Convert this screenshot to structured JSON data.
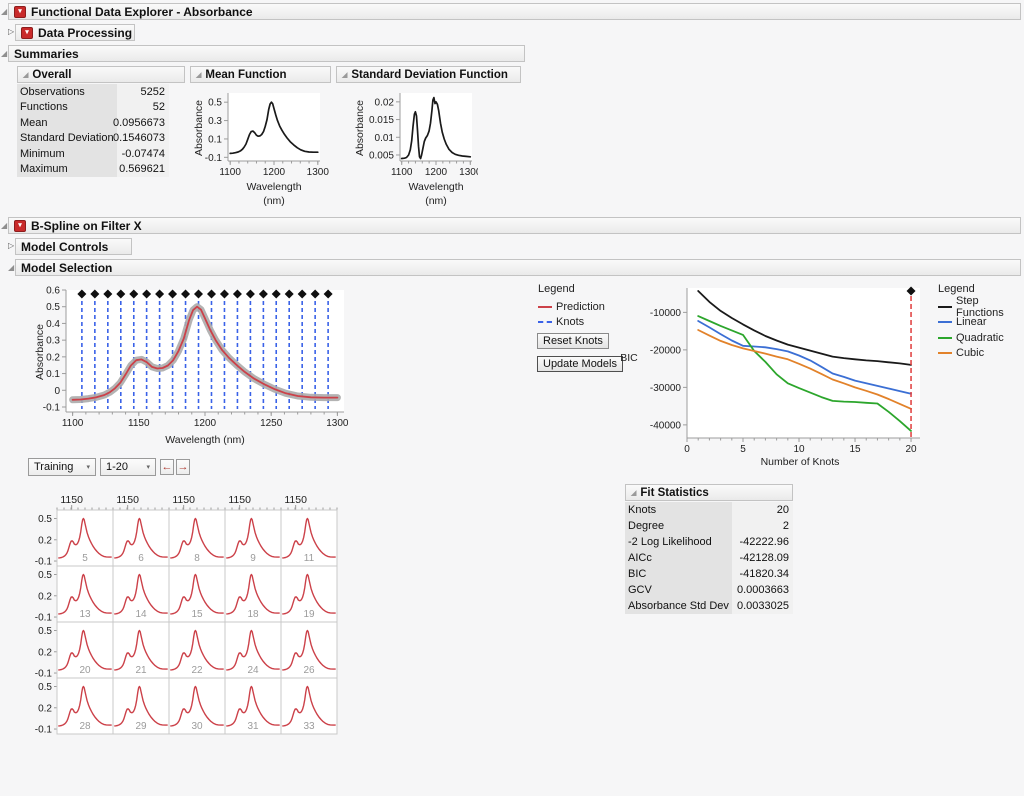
{
  "titles": {
    "fde": "Functional Data Explorer - Absorbance",
    "data_processing": "Data Processing",
    "summaries": "Summaries",
    "overall": "Overall",
    "mean_function": "Mean Function",
    "std_dev_function": "Standard Deviation Function",
    "bspline": "B-Spline on Filter X",
    "model_controls": "Model Controls",
    "model_selection": "Model Selection",
    "fit_statistics": "Fit Statistics"
  },
  "overall_table": {
    "rows": [
      {
        "label": "Observations",
        "value": "5252"
      },
      {
        "label": "Functions",
        "value": "52"
      },
      {
        "label": "Mean",
        "value": "0.0956673"
      },
      {
        "label": "Standard Deviation",
        "value": "0.1546073"
      },
      {
        "label": "Minimum",
        "value": "-0.07474"
      },
      {
        "label": "Maximum",
        "value": "0.569621"
      }
    ]
  },
  "fit_table": {
    "rows": [
      {
        "label": "Knots",
        "value": "20"
      },
      {
        "label": "Degree",
        "value": "2"
      },
      {
        "label": "-2 Log Likelihood",
        "value": "-42222.96"
      },
      {
        "label": "AICc",
        "value": "-42128.09"
      },
      {
        "label": "BIC",
        "value": "-41820.34"
      },
      {
        "label": "GCV",
        "value": "0.0003663"
      },
      {
        "label": "Absorbance Std Dev",
        "value": "0.0033025"
      }
    ]
  },
  "spline_legend": {
    "title": "Legend",
    "items": [
      {
        "label": "Prediction",
        "color": "#cc4149",
        "dash": "solid"
      },
      {
        "label": "Knots",
        "color": "#3a62e8",
        "dash": "dashed"
      }
    ]
  },
  "bic_legend": {
    "title": "Legend",
    "items": [
      {
        "label": "Step Functions",
        "color": "#1a1a1a",
        "dash": "solid"
      },
      {
        "label": "Linear",
        "color": "#3b6fd4",
        "dash": "solid"
      },
      {
        "label": "Quadratic",
        "color": "#2ca62c",
        "dash": "solid"
      },
      {
        "label": "Cubic",
        "color": "#e2822a",
        "dash": "solid"
      }
    ]
  },
  "buttons": {
    "reset_knots": "Reset Knots",
    "update_models": "Update Models"
  },
  "pager": {
    "set": "Training",
    "range": "1-20",
    "prev": "←",
    "next": "→"
  },
  "chart_data": [
    {
      "id": "mean_function",
      "type": "line",
      "title": "Mean Function",
      "xlabel": "Wavelength (nm)",
      "xlabel_lines": [
        "Wavelength",
        "(nm)"
      ],
      "ylabel": "Absorbance",
      "xlim": [
        1095,
        1305
      ],
      "ylim": [
        -0.14,
        0.6
      ],
      "xticks": [
        1100,
        1200,
        1300
      ],
      "yticks": [
        0.5,
        0.3,
        0.1,
        -0.1
      ],
      "series": [
        {
          "name": "Mean",
          "color": "#1a1a1a",
          "width": 1.7,
          "x": [
            1100,
            1106,
            1112,
            1118,
            1124,
            1128,
            1132,
            1136,
            1140,
            1144,
            1148,
            1152,
            1156,
            1160,
            1164,
            1168,
            1172,
            1176,
            1180,
            1184,
            1188,
            1191,
            1194,
            1197,
            1200,
            1204,
            1208,
            1213,
            1218,
            1224,
            1230,
            1237,
            1245,
            1253,
            1261,
            1270,
            1280,
            1290,
            1300
          ],
          "y": [
            -0.057,
            -0.055,
            -0.05,
            -0.042,
            -0.028,
            -0.012,
            0.012,
            0.045,
            0.095,
            0.148,
            0.18,
            0.185,
            0.168,
            0.14,
            0.13,
            0.133,
            0.148,
            0.18,
            0.235,
            0.31,
            0.42,
            0.48,
            0.5,
            0.482,
            0.43,
            0.36,
            0.3,
            0.24,
            0.195,
            0.15,
            0.11,
            0.07,
            0.035,
            0.005,
            -0.018,
            -0.034,
            -0.042,
            -0.044,
            -0.044
          ]
        }
      ]
    },
    {
      "id": "std_dev_function",
      "type": "line",
      "title": "Standard Deviation Function",
      "xlabel": "Wavelength (nm)",
      "xlabel_lines": [
        "Wavelength",
        "(nm)"
      ],
      "ylabel": "Absorbance",
      "xlim": [
        1095,
        1305
      ],
      "ylim": [
        0.0033,
        0.0225
      ],
      "xticks": [
        1100,
        1200,
        1300
      ],
      "yticks": [
        0.02,
        0.015,
        0.01,
        0.005
      ],
      "series": [
        {
          "name": "Std Dev",
          "color": "#1a1a1a",
          "width": 1.7,
          "x": [
            1100,
            1108,
            1114,
            1120,
            1125,
            1129,
            1133,
            1137,
            1140,
            1143,
            1146,
            1149,
            1152,
            1155,
            1158,
            1162,
            1166,
            1170,
            1175,
            1180,
            1184,
            1188,
            1191,
            1194,
            1197,
            1200,
            1204,
            1208,
            1213,
            1218,
            1224,
            1230,
            1238,
            1247,
            1256,
            1266,
            1277,
            1288,
            1300
          ],
          "y": [
            0.004,
            0.0041,
            0.0043,
            0.005,
            0.0065,
            0.009,
            0.013,
            0.0165,
            0.0172,
            0.016,
            0.012,
            0.0075,
            0.0045,
            0.004,
            0.005,
            0.007,
            0.0088,
            0.0098,
            0.0105,
            0.0118,
            0.014,
            0.0175,
            0.0205,
            0.0212,
            0.0195,
            0.02,
            0.0193,
            0.0175,
            0.014,
            0.0115,
            0.0095,
            0.008,
            0.0066,
            0.0057,
            0.0052,
            0.0049,
            0.0047,
            0.0046,
            0.0045
          ]
        }
      ]
    },
    {
      "id": "spline_fit",
      "type": "line",
      "title": "",
      "xlabel": "Wavelength (nm)",
      "ylabel": "Absorbance",
      "xlim": [
        1095,
        1305
      ],
      "ylim": [
        -0.13,
        0.6
      ],
      "xticks": [
        1100,
        1150,
        1200,
        1250,
        1300
      ],
      "yticks": [
        0.6,
        0.5,
        0.4,
        0.3,
        0.2,
        0.1,
        0,
        -0.1
      ],
      "knots": {
        "positions": [
          1107,
          1116.8,
          1126.6,
          1136.4,
          1146.2,
          1155.9,
          1165.7,
          1175.5,
          1185.3,
          1195.1,
          1204.9,
          1214.7,
          1224.5,
          1234.3,
          1244.1,
          1253.8,
          1263.6,
          1273.4,
          1283.2,
          1293
        ],
        "color": "#3a62e8",
        "handle_color": "#111111"
      },
      "series": [
        {
          "name": "Observed",
          "color": "#ababab",
          "width": 7,
          "opacity": 0.9,
          "use_series_of": [
            0,
            0
          ]
        },
        {
          "name": "Prediction",
          "color": "#cc4149",
          "width": 1.8,
          "use_series_of": [
            0,
            0
          ]
        }
      ]
    },
    {
      "id": "bic_model_comparison",
      "type": "line",
      "title": "",
      "xlabel": "Number of Knots",
      "ylabel": "BIC",
      "xlim": [
        0,
        20.8
      ],
      "ylim": [
        -43500,
        -3500
      ],
      "xticks": [
        0,
        5,
        10,
        15,
        20
      ],
      "yticks": [
        -10000,
        -20000,
        -30000,
        -40000
      ],
      "vline": {
        "x": 20,
        "color": "#e03c3c",
        "diamond": true
      },
      "series": [
        {
          "name": "Step Functions",
          "color": "#1a1a1a",
          "width": 1.8,
          "x": [
            1,
            2,
            3,
            4,
            5,
            6,
            7,
            8,
            9,
            10,
            11,
            12,
            13,
            14,
            15,
            16,
            17,
            18,
            19,
            20
          ],
          "y": [
            -4300,
            -7200,
            -9600,
            -11500,
            -13200,
            -14800,
            -16300,
            -17500,
            -18600,
            -19400,
            -20200,
            -21000,
            -21800,
            -22200,
            -22500,
            -22800,
            -23000,
            -23300,
            -23600,
            -24000
          ]
        },
        {
          "name": "Linear",
          "color": "#3b6fd4",
          "width": 1.8,
          "x": [
            1,
            2,
            3,
            4,
            5,
            6,
            7,
            8,
            9,
            10,
            11,
            12,
            13,
            14,
            15,
            16,
            17,
            18,
            19,
            20
          ],
          "y": [
            -12300,
            -14000,
            -15800,
            -17500,
            -18900,
            -19100,
            -19300,
            -19800,
            -20400,
            -21500,
            -22800,
            -24500,
            -26300,
            -27200,
            -28200,
            -28900,
            -29600,
            -30300,
            -31000,
            -31700
          ]
        },
        {
          "name": "Quadratic",
          "color": "#2ca62c",
          "width": 1.8,
          "x": [
            1,
            2,
            3,
            4,
            5,
            6,
            7,
            8,
            9,
            10,
            11,
            12,
            13,
            14,
            15,
            16,
            17,
            18,
            19,
            20
          ],
          "y": [
            -11000,
            -12300,
            -13600,
            -14800,
            -16000,
            -20300,
            -23200,
            -26500,
            -28900,
            -30200,
            -31400,
            -32600,
            -33600,
            -33800,
            -33900,
            -34100,
            -34300,
            -36500,
            -39000,
            -41600
          ]
        },
        {
          "name": "Cubic",
          "color": "#e2822a",
          "width": 1.8,
          "x": [
            1,
            2,
            3,
            4,
            5,
            6,
            7,
            8,
            9,
            10,
            11,
            12,
            13,
            14,
            15,
            16,
            17,
            18,
            19,
            20
          ],
          "y": [
            -14700,
            -16200,
            -17600,
            -18700,
            -19600,
            -20300,
            -21000,
            -21800,
            -22500,
            -23700,
            -25000,
            -26400,
            -27900,
            -28900,
            -30000,
            -30900,
            -31900,
            -33100,
            -34400,
            -35700
          ]
        }
      ]
    },
    {
      "id": "function_grid",
      "type": "grid",
      "x_tick_label": "1150",
      "x_tick_value": 1150,
      "row_yticks": [
        "0.5",
        "0.2",
        "-0.1"
      ],
      "row_ytick_values": [
        0.5,
        0.2,
        -0.1
      ],
      "cell_ids": [
        "5",
        "6",
        "8",
        "9",
        "11",
        "13",
        "14",
        "15",
        "18",
        "19",
        "20",
        "21",
        "22",
        "24",
        "26",
        "28",
        "29",
        "30",
        "31",
        "33"
      ],
      "columns": 5,
      "xlim": [
        1095,
        1305
      ],
      "ylim": [
        -0.17,
        0.62
      ],
      "curve_color": "#cc4149",
      "curve_use": [
        0,
        0
      ]
    }
  ]
}
